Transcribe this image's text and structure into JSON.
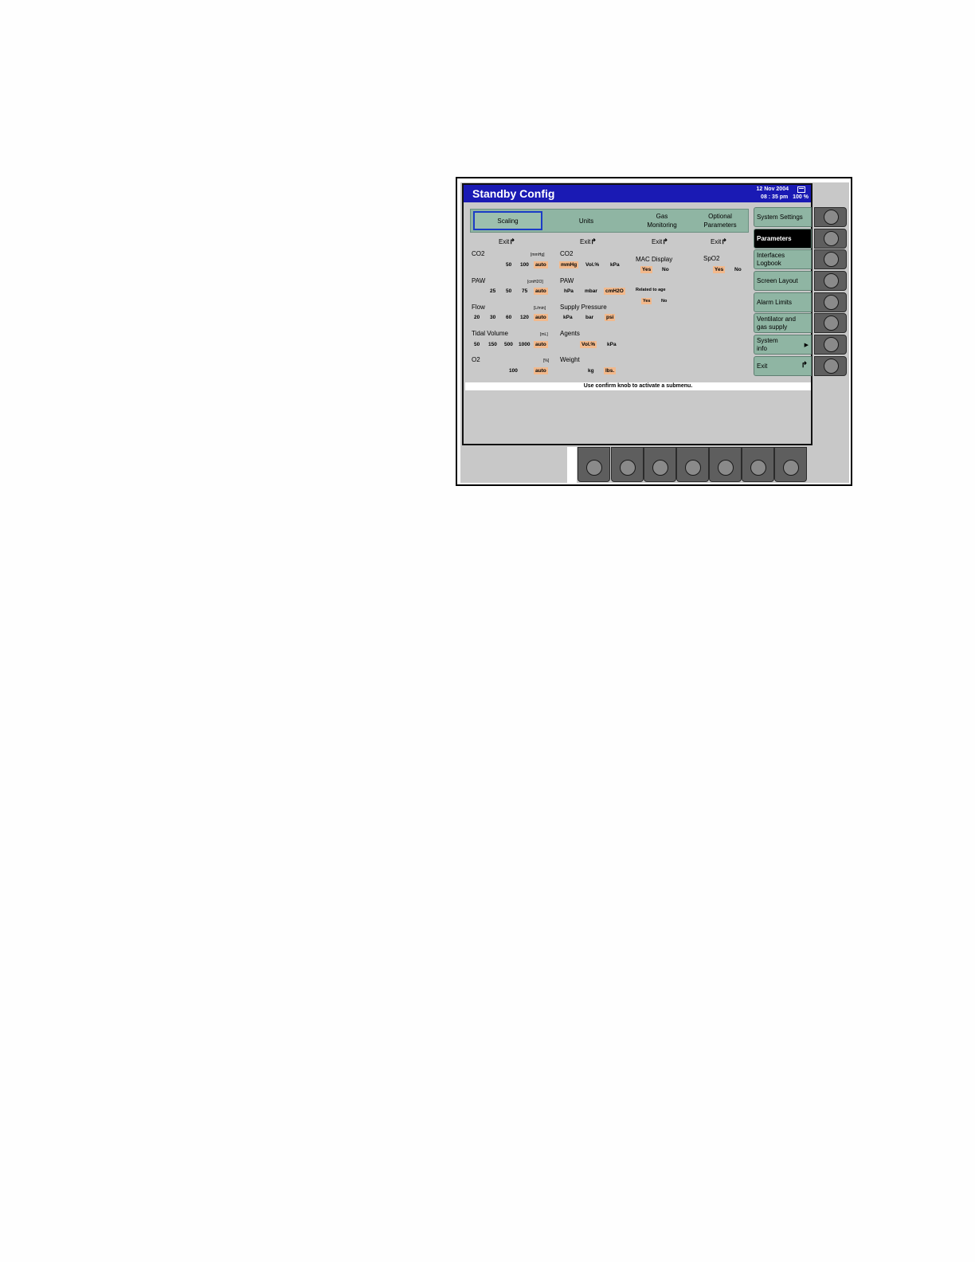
{
  "title": "Standby Config",
  "header": {
    "date": "12 Nov 2004",
    "time": "08 : 35 pm",
    "level": "100 %"
  },
  "tabs": {
    "scaling": "Scaling",
    "units": "Units",
    "gas": "Gas\nMonitoring",
    "optional": "Optional\nParameters"
  },
  "exit_label": "Exit",
  "scaling": {
    "co2": {
      "label": "CO2",
      "unit": "[mmHg]",
      "opts": [
        "50",
        "100"
      ],
      "selected": "auto"
    },
    "paw": {
      "label": "PAW",
      "unit": "[cmH2O]",
      "opts": [
        "25",
        "50",
        "75"
      ],
      "selected": "auto"
    },
    "flow": {
      "label": "Flow",
      "unit": "[L/min]",
      "opts": [
        "20",
        "30",
        "60",
        "120"
      ],
      "selected": "auto"
    },
    "tidal": {
      "label": "Tidal Volume",
      "unit": "[mL]",
      "opts": [
        "50",
        "150",
        "500",
        "1000"
      ],
      "selected": "auto"
    },
    "o2": {
      "label": "O2",
      "unit": "[%]",
      "opts": [
        "100"
      ],
      "selected": "auto"
    }
  },
  "units": {
    "co2": {
      "label": "CO2",
      "selected": "mmHg",
      "opts": [
        "Vol.%",
        "kPa"
      ]
    },
    "paw": {
      "label": "PAW",
      "opts": [
        "hPa",
        "mbar"
      ],
      "selected": "cmH2O"
    },
    "supply": {
      "label": "Supply Pressure",
      "opts": [
        "kPa",
        "bar"
      ],
      "selected": "psi"
    },
    "agents": {
      "label": "Agents",
      "selected": "Vol.%",
      "opts": [
        "kPa"
      ]
    },
    "weight": {
      "label": "Weight",
      "opts": [
        "kg"
      ],
      "selected": "lbs."
    }
  },
  "gas": {
    "mac": {
      "label": "MAC Display",
      "selected": "Yes",
      "other": "No"
    },
    "age": {
      "label": "Related to age",
      "selected": "Yes",
      "other": "No"
    }
  },
  "optional": {
    "spo2": {
      "label": "SpO2",
      "selected": "Yes",
      "other": "No"
    }
  },
  "menu": [
    "System Settings",
    "Parameters",
    "Interfaces\nLogbook",
    "Screen Layout",
    "Alarm Limits",
    "Ventilator and\ngas supply",
    "System\ninfo",
    "Exit"
  ],
  "status": "Use confirm knob to activate a submenu."
}
